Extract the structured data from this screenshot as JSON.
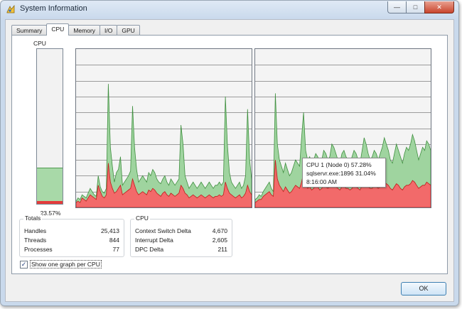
{
  "window": {
    "title": "System Information",
    "buttons": {
      "minimize": "—",
      "maximize": "□",
      "close": "✕"
    }
  },
  "tabs": [
    {
      "label": "Summary",
      "active": false
    },
    {
      "label": "CPU",
      "active": true
    },
    {
      "label": "Memory",
      "active": false
    },
    {
      "label": "I/O",
      "active": false
    },
    {
      "label": "GPU",
      "active": false
    }
  ],
  "cpu_gauge": {
    "caption": "CPU",
    "value_label": "23.57%",
    "total_fraction": 0.2357,
    "kernel_fraction": 0.02
  },
  "tooltip": {
    "line1": "CPU 1 (Node 0) 57.28%",
    "line2": "sqlservr.exe:1896 31.04%",
    "line3": "8:16:00 AM"
  },
  "totals": {
    "title": "Totals",
    "rows": [
      {
        "label": "Handles",
        "value": "25,413"
      },
      {
        "label": "Threads",
        "value": "844"
      },
      {
        "label": "Processes",
        "value": "77"
      }
    ]
  },
  "cpu_stats": {
    "title": "CPU",
    "rows": [
      {
        "label": "Context Switch Delta",
        "value": "4,670"
      },
      {
        "label": "Interrupt Delta",
        "value": "2,605"
      },
      {
        "label": "DPC Delta",
        "value": "211"
      }
    ]
  },
  "checkbox": {
    "label": "Show one graph per CPU",
    "checked": true,
    "mark": "✓"
  },
  "ok_button": {
    "label": "OK"
  },
  "colors": {
    "total_fill": "#9fd49f",
    "total_line": "#3f8f3f",
    "kernel_fill": "#f26a6a",
    "kernel_line": "#c21a1a",
    "grid": "#9c9c9c",
    "graph_bg": "#f4f4f4"
  },
  "chart_data": {
    "type": "area",
    "ylim": [
      0,
      100
    ],
    "grid": true,
    "graphs": [
      {
        "name": "CPU 0",
        "series": [
          {
            "name": "total",
            "values": [
              4,
              6,
              5,
              8,
              7,
              6,
              9,
              12,
              10,
              8,
              7,
              20,
              13,
              10,
              9,
              12,
              78,
              38,
              26,
              16,
              22,
              24,
              32,
              14,
              16,
              18,
              20,
              23,
              64,
              38,
              24,
              16,
              18,
              20,
              18,
              16,
              22,
              20,
              24,
              22,
              18,
              16,
              15,
              18,
              20,
              16,
              14,
              18,
              16,
              14,
              16,
              18,
              52,
              40,
              20,
              16,
              12,
              14,
              16,
              14,
              12,
              14,
              16,
              14,
              12,
              14,
              16,
              14,
              12,
              14,
              14,
              16,
              14,
              16,
              70,
              40,
              22,
              16,
              14,
              12,
              14,
              16,
              12,
              14,
              20,
              62,
              30,
              18
            ]
          },
          {
            "name": "kernel",
            "values": [
              3,
              4,
              3,
              6,
              5,
              4,
              6,
              8,
              7,
              6,
              5,
              14,
              10,
              7,
              6,
              8,
              28,
              16,
              12,
              9,
              10,
              12,
              14,
              8,
              9,
              10,
              11,
              12,
              18,
              14,
              10,
              8,
              9,
              10,
              9,
              8,
              11,
              10,
              12,
              11,
              9,
              8,
              7,
              9,
              10,
              8,
              7,
              9,
              8,
              7,
              8,
              9,
              14,
              12,
              9,
              8,
              6,
              7,
              8,
              7,
              6,
              7,
              8,
              7,
              6,
              7,
              8,
              7,
              6,
              7,
              7,
              8,
              7,
              8,
              16,
              12,
              9,
              8,
              7,
              6,
              7,
              8,
              6,
              7,
              9,
              14,
              10,
              8
            ]
          }
        ]
      },
      {
        "name": "CPU 1",
        "series": [
          {
            "name": "total",
            "values": [
              5,
              6,
              8,
              7,
              10,
              12,
              14,
              16,
              12,
              10,
              72,
              40,
              30,
              26,
              22,
              28,
              24,
              20,
              22,
              26,
              30,
              28,
              26,
              44,
              60,
              36,
              30,
              32,
              28,
              30,
              34,
              32,
              28,
              30,
              36,
              34,
              30,
              32,
              40,
              38,
              34,
              30,
              28,
              34,
              36,
              32,
              30,
              28,
              32,
              36,
              34,
              30,
              28,
              36,
              44,
              40,
              34,
              30,
              32,
              36,
              34,
              30,
              34,
              38,
              44,
              40,
              36,
              30,
              28,
              34,
              40,
              36,
              32,
              28,
              34,
              38,
              36,
              40,
              46,
              42,
              36,
              30,
              34,
              38,
              36,
              42,
              40,
              36
            ]
          },
          {
            "name": "kernel",
            "values": [
              3,
              4,
              5,
              5,
              7,
              8,
              9,
              10,
              8,
              7,
              30,
              18,
              14,
              12,
              10,
              13,
              11,
              9,
              10,
              12,
              14,
              13,
              12,
              16,
              22,
              14,
              12,
              13,
              11,
              12,
              14,
              13,
              11,
              12,
              14,
              13,
              12,
              13,
              15,
              14,
              13,
              12,
              11,
              13,
              14,
              12,
              12,
              11,
              12,
              14,
              13,
              12,
              11,
              14,
              16,
              15,
              13,
              12,
              12,
              14,
              13,
              12,
              13,
              14,
              16,
              15,
              14,
              12,
              11,
              13,
              15,
              14,
              12,
              11,
              13,
              14,
              14,
              15,
              17,
              16,
              14,
              12,
              13,
              14,
              14,
              16,
              15,
              14
            ]
          }
        ]
      }
    ]
  }
}
